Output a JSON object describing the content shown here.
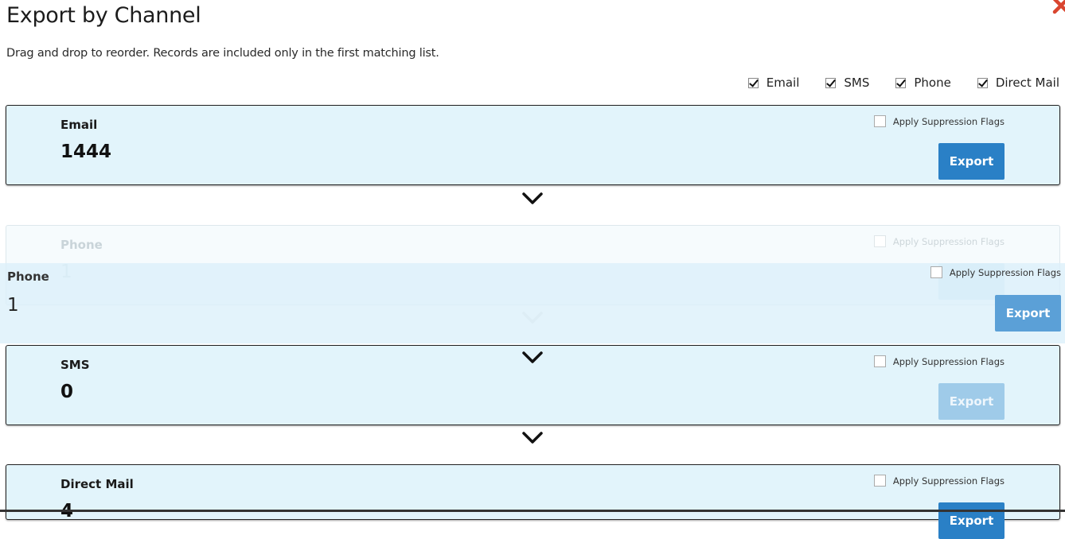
{
  "dialog": {
    "title": "Export by Channel",
    "subtitle": "Drag and drop to reorder. Records are included only in the first matching list.",
    "close_icon": "close-icon"
  },
  "filters": [
    {
      "label": "Email",
      "checked": true
    },
    {
      "label": "SMS",
      "checked": true
    },
    {
      "label": "Phone",
      "checked": true
    },
    {
      "label": "Direct Mail",
      "checked": true
    }
  ],
  "suppression_label": "Apply Suppression Flags",
  "export_label": "Export",
  "cards": [
    {
      "name": "Email",
      "count": "1444",
      "export_enabled": true,
      "suppression_checked": false
    },
    {
      "name": "Phone",
      "count": "1",
      "export_enabled": true,
      "suppression_checked": false
    },
    {
      "name": "SMS",
      "count": "0",
      "export_enabled": false,
      "suppression_checked": false
    },
    {
      "name": "Direct Mail",
      "count": "4",
      "export_enabled": true,
      "suppression_checked": false
    }
  ],
  "dragging_card": {
    "name": "Phone",
    "count": "1"
  },
  "icons": {
    "chevron": "chevron-down-icon",
    "close": "close-icon"
  },
  "colors": {
    "card_background": "#e2f4fb",
    "export_button": "#2a80c6",
    "export_button_disabled": "#9fcbe9",
    "close_icon": "#d9452f"
  }
}
